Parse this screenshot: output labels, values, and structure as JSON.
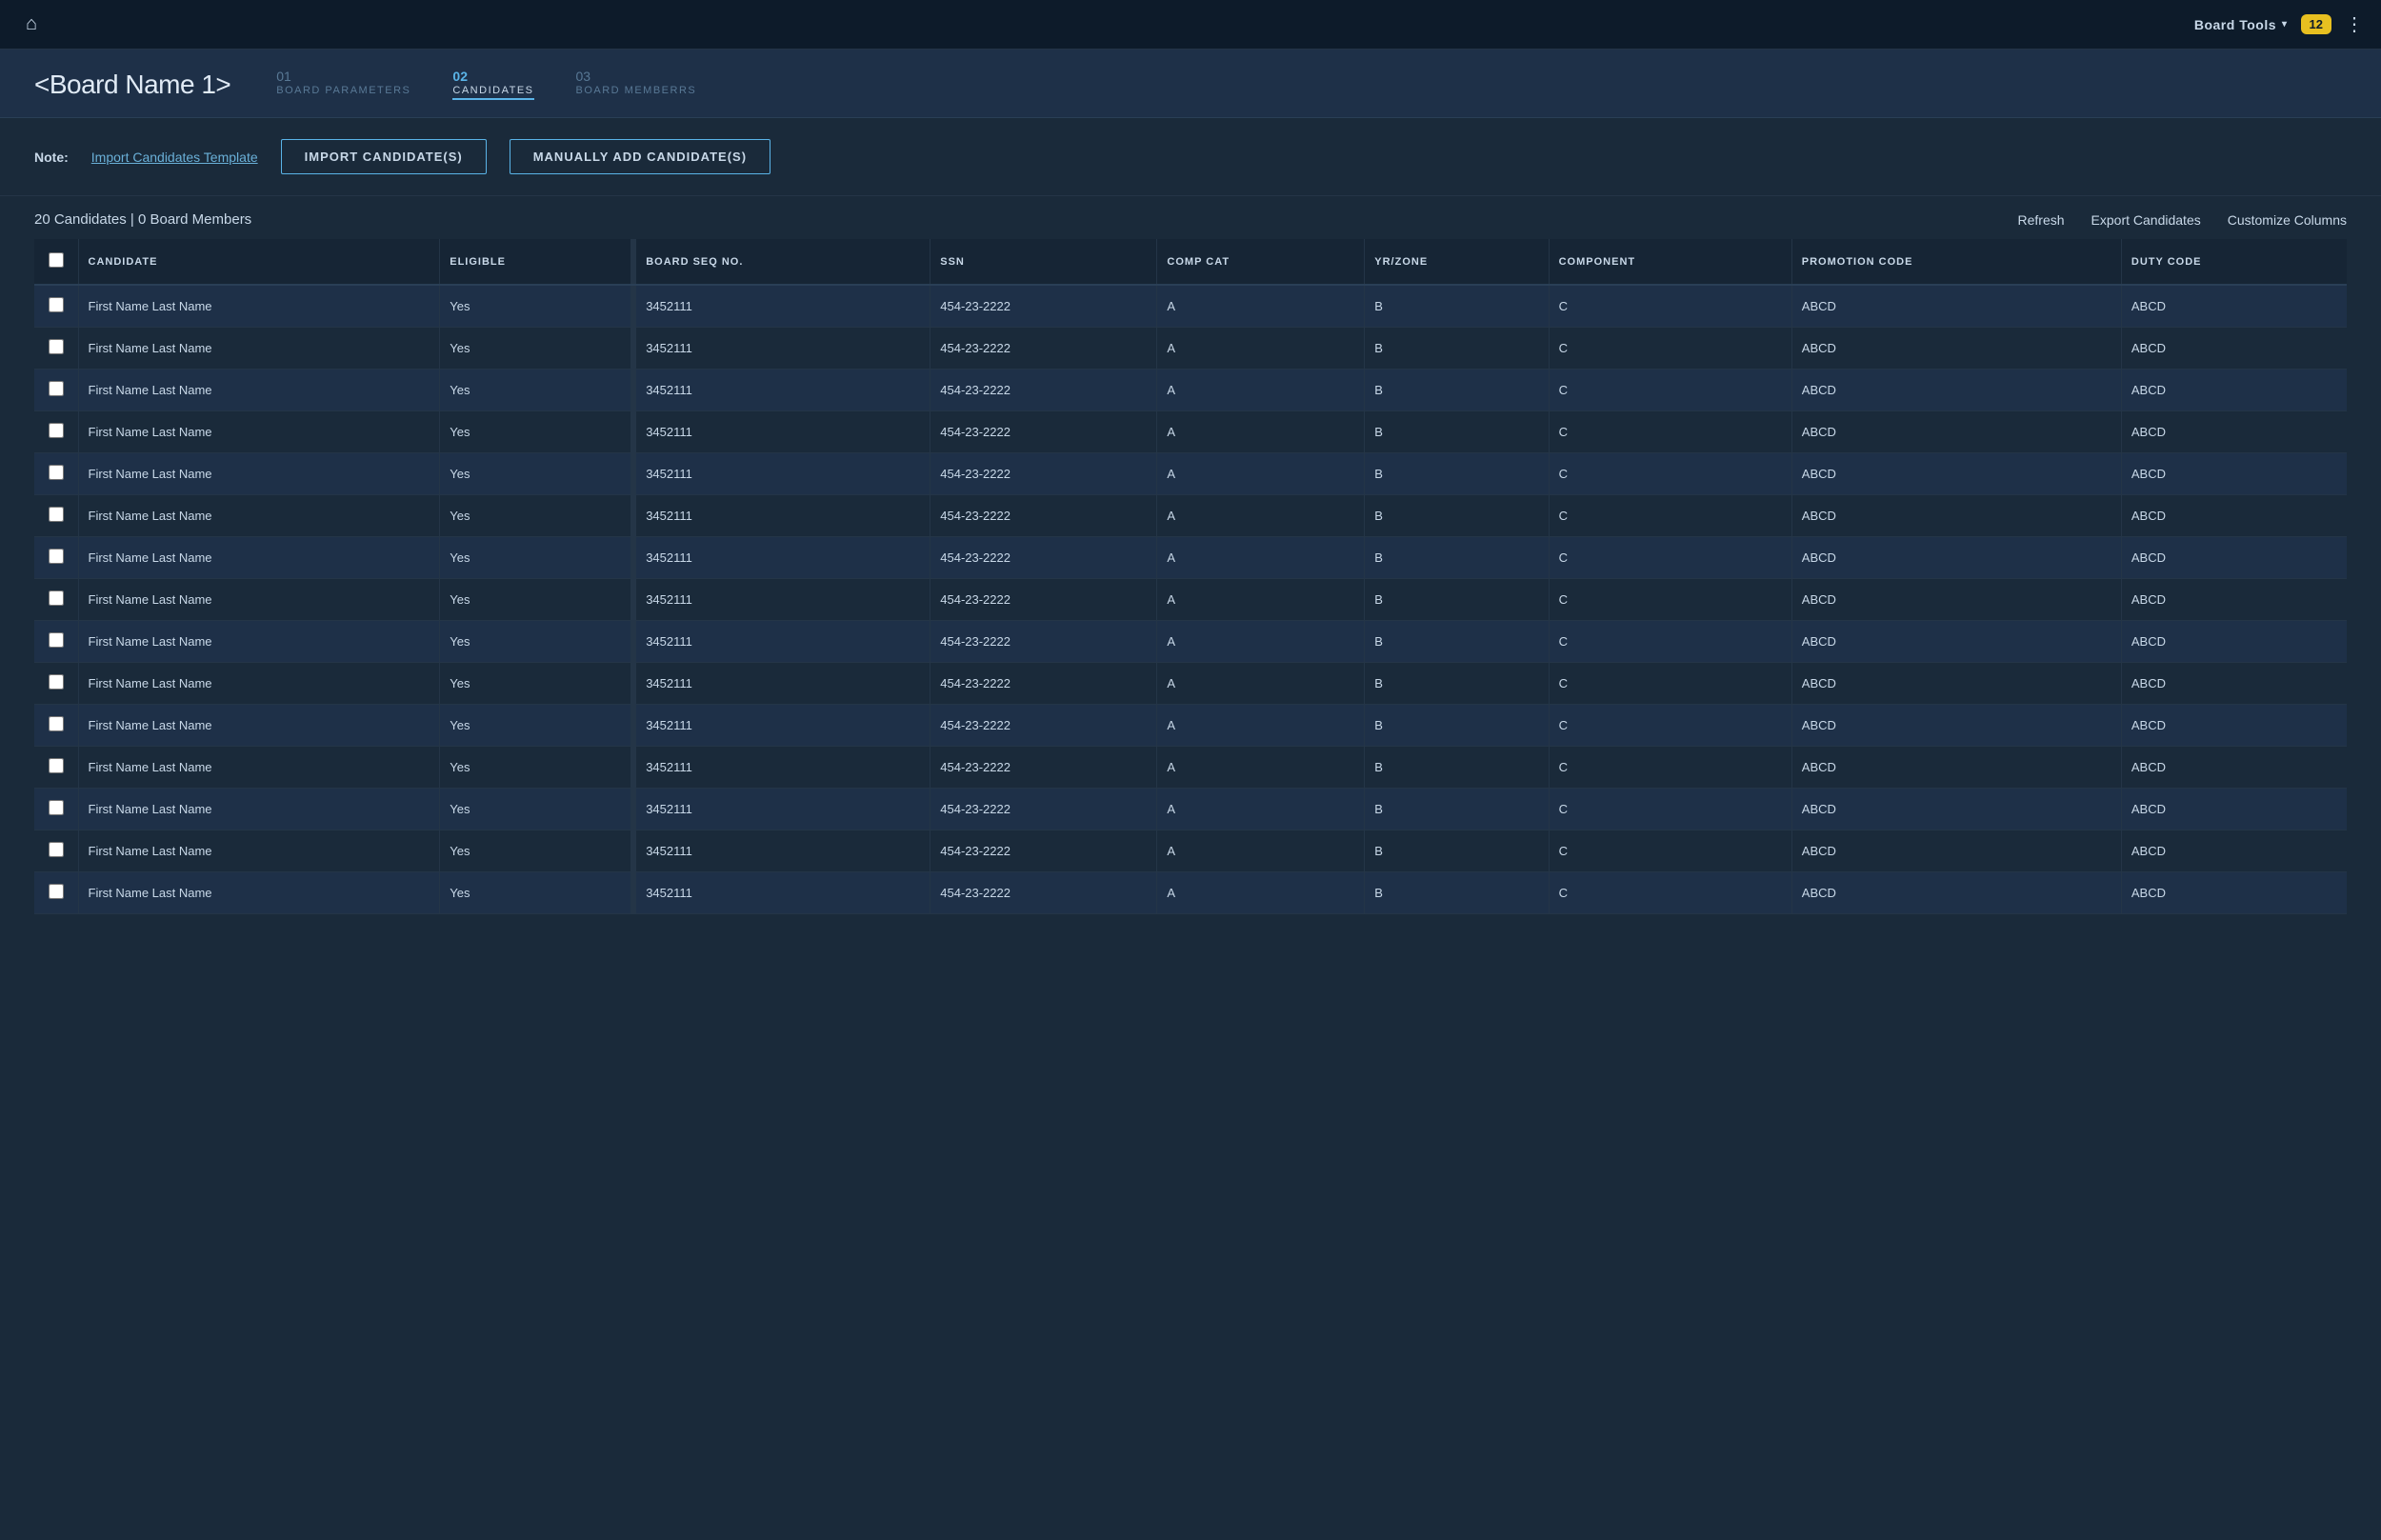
{
  "nav": {
    "home_icon": "⌂",
    "board_tools_label": "Board Tools",
    "chevron": "▾",
    "notif_count": "12",
    "more_icon": "⋮"
  },
  "header": {
    "board_title": "<Board Name 1>",
    "steps": [
      {
        "id": "step1",
        "num": "01",
        "label": "BOARD PARAMETERS",
        "active": false
      },
      {
        "id": "step2",
        "num": "02",
        "label": "CANDIDATES",
        "active": true
      },
      {
        "id": "step3",
        "num": "03",
        "label": "BOARD MEMBERRS",
        "active": false
      }
    ]
  },
  "toolbar": {
    "note_label": "Note:",
    "import_template_link": "Import Candidates Template",
    "import_btn": "IMPORT CANDIDATE(S)",
    "manually_add_btn": "MANUALLY ADD CANDIDATE(S)"
  },
  "table_meta": {
    "summary": "20 Candidates | 0 Board Members",
    "refresh_label": "Refresh",
    "export_label": "Export Candidates",
    "customize_label": "Customize Columns"
  },
  "table": {
    "columns": [
      {
        "id": "checkbox",
        "label": ""
      },
      {
        "id": "candidate",
        "label": "CANDIDATE"
      },
      {
        "id": "eligible",
        "label": "ELIGIBLE"
      },
      {
        "id": "board_seq_no",
        "label": "BOARD SEQ NO."
      },
      {
        "id": "ssn",
        "label": "SSN"
      },
      {
        "id": "comp_cat",
        "label": "COMP CAT"
      },
      {
        "id": "yr_zone",
        "label": "YR/ZONE"
      },
      {
        "id": "component",
        "label": "COMPONENT"
      },
      {
        "id": "promotion_code",
        "label": "PROMOTION CODE"
      },
      {
        "id": "duty_code",
        "label": "DUTY CODE"
      }
    ],
    "rows": [
      {
        "name": "First Name Last Name",
        "eligible": "Yes",
        "board_seq": "3452111",
        "ssn": "454-23-2222",
        "comp_cat": "A",
        "yr_zone": "B",
        "component": "C",
        "promotion_code": "ABCD",
        "duty_code": "ABCD"
      },
      {
        "name": "First Name Last Name",
        "eligible": "Yes",
        "board_seq": "3452111",
        "ssn": "454-23-2222",
        "comp_cat": "A",
        "yr_zone": "B",
        "component": "C",
        "promotion_code": "ABCD",
        "duty_code": "ABCD"
      },
      {
        "name": "First Name Last Name",
        "eligible": "Yes",
        "board_seq": "3452111",
        "ssn": "454-23-2222",
        "comp_cat": "A",
        "yr_zone": "B",
        "component": "C",
        "promotion_code": "ABCD",
        "duty_code": "ABCD"
      },
      {
        "name": "First Name Last Name",
        "eligible": "Yes",
        "board_seq": "3452111",
        "ssn": "454-23-2222",
        "comp_cat": "A",
        "yr_zone": "B",
        "component": "C",
        "promotion_code": "ABCD",
        "duty_code": "ABCD"
      },
      {
        "name": "First Name Last Name",
        "eligible": "Yes",
        "board_seq": "3452111",
        "ssn": "454-23-2222",
        "comp_cat": "A",
        "yr_zone": "B",
        "component": "C",
        "promotion_code": "ABCD",
        "duty_code": "ABCD"
      },
      {
        "name": "First Name Last Name",
        "eligible": "Yes",
        "board_seq": "3452111",
        "ssn": "454-23-2222",
        "comp_cat": "A",
        "yr_zone": "B",
        "component": "C",
        "promotion_code": "ABCD",
        "duty_code": "ABCD"
      },
      {
        "name": "First Name Last Name",
        "eligible": "Yes",
        "board_seq": "3452111",
        "ssn": "454-23-2222",
        "comp_cat": "A",
        "yr_zone": "B",
        "component": "C",
        "promotion_code": "ABCD",
        "duty_code": "ABCD"
      },
      {
        "name": "First Name Last Name",
        "eligible": "Yes",
        "board_seq": "3452111",
        "ssn": "454-23-2222",
        "comp_cat": "A",
        "yr_zone": "B",
        "component": "C",
        "promotion_code": "ABCD",
        "duty_code": "ABCD"
      },
      {
        "name": "First Name Last Name",
        "eligible": "Yes",
        "board_seq": "3452111",
        "ssn": "454-23-2222",
        "comp_cat": "A",
        "yr_zone": "B",
        "component": "C",
        "promotion_code": "ABCD",
        "duty_code": "ABCD"
      },
      {
        "name": "First Name Last Name",
        "eligible": "Yes",
        "board_seq": "3452111",
        "ssn": "454-23-2222",
        "comp_cat": "A",
        "yr_zone": "B",
        "component": "C",
        "promotion_code": "ABCD",
        "duty_code": "ABCD"
      },
      {
        "name": "First Name Last Name",
        "eligible": "Yes",
        "board_seq": "3452111",
        "ssn": "454-23-2222",
        "comp_cat": "A",
        "yr_zone": "B",
        "component": "C",
        "promotion_code": "ABCD",
        "duty_code": "ABCD"
      },
      {
        "name": "First Name Last Name",
        "eligible": "Yes",
        "board_seq": "3452111",
        "ssn": "454-23-2222",
        "comp_cat": "A",
        "yr_zone": "B",
        "component": "C",
        "promotion_code": "ABCD",
        "duty_code": "ABCD"
      },
      {
        "name": "First Name Last Name",
        "eligible": "Yes",
        "board_seq": "3452111",
        "ssn": "454-23-2222",
        "comp_cat": "A",
        "yr_zone": "B",
        "component": "C",
        "promotion_code": "ABCD",
        "duty_code": "ABCD"
      },
      {
        "name": "First Name Last Name",
        "eligible": "Yes",
        "board_seq": "3452111",
        "ssn": "454-23-2222",
        "comp_cat": "A",
        "yr_zone": "B",
        "component": "C",
        "promotion_code": "ABCD",
        "duty_code": "ABCD"
      },
      {
        "name": "First Name Last Name",
        "eligible": "Yes",
        "board_seq": "3452111",
        "ssn": "454-23-2222",
        "comp_cat": "A",
        "yr_zone": "B",
        "component": "C",
        "promotion_code": "ABCD",
        "duty_code": "ABCD"
      }
    ]
  }
}
